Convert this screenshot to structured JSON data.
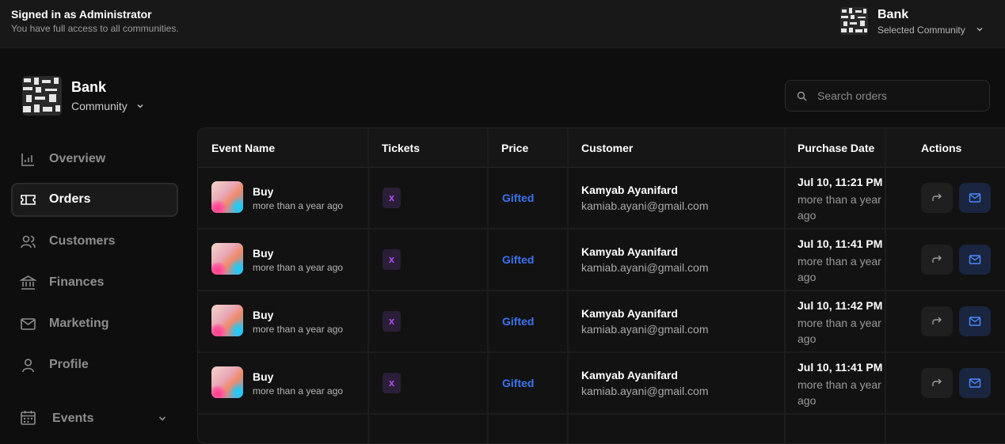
{
  "header": {
    "signed_in": "Signed in as Administrator",
    "access_note": "You have full access to all communities.",
    "community_name": "Bank",
    "community_label": "Selected Community"
  },
  "sidebar": {
    "community_name": "Bank",
    "community_type": "Community",
    "items": [
      {
        "label": "Overview",
        "icon": "chart-icon",
        "active": false
      },
      {
        "label": "Orders",
        "icon": "ticket-icon",
        "active": true
      },
      {
        "label": "Customers",
        "icon": "users-icon",
        "active": false
      },
      {
        "label": "Finances",
        "icon": "bank-icon",
        "active": false
      },
      {
        "label": "Marketing",
        "icon": "mail-icon",
        "active": false
      },
      {
        "label": "Profile",
        "icon": "user-icon",
        "active": false
      },
      {
        "label": "Events",
        "icon": "calendar-icon",
        "active": false
      }
    ]
  },
  "search": {
    "placeholder": "Search orders"
  },
  "table": {
    "columns": [
      "Event Name",
      "Tickets",
      "Price",
      "Customer",
      "Purchase Date",
      "Actions"
    ],
    "rows": [
      {
        "event": "Buy",
        "event_time": "more than a year ago",
        "tickets": "x",
        "price": "Gifted",
        "customer": "Kamyab Ayanifard",
        "email": "kamiab.ayani@gmail.com",
        "date": "Jul 10, 11:21 PM",
        "relative": "more than a year ago"
      },
      {
        "event": "Buy",
        "event_time": "more than a year ago",
        "tickets": "x",
        "price": "Gifted",
        "customer": "Kamyab Ayanifard",
        "email": "kamiab.ayani@gmail.com",
        "date": "Jul 10, 11:41 PM",
        "relative": "more than a year ago"
      },
      {
        "event": "Buy",
        "event_time": "more than a year ago",
        "tickets": "x",
        "price": "Gifted",
        "customer": "Kamyab Ayanifard",
        "email": "kamiab.ayani@gmail.com",
        "date": "Jul 10, 11:42 PM",
        "relative": "more than a year ago"
      },
      {
        "event": "Buy",
        "event_time": "more than a year ago",
        "tickets": "x",
        "price": "Gifted",
        "customer": "Kamyab Ayanifard",
        "email": "kamiab.ayani@gmail.com",
        "date": "Jul 10, 11:41 PM",
        "relative": "more than a year ago"
      }
    ]
  },
  "colors": {
    "accent": "#3b73f0",
    "ticket": "#b04bf2",
    "background": "#0e0e0e"
  }
}
